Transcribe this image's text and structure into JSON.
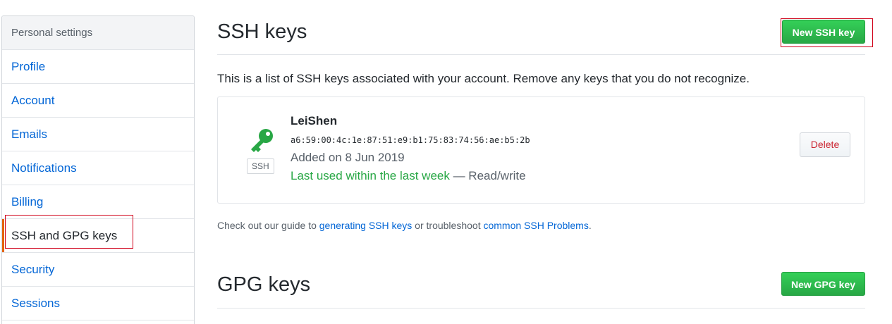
{
  "sidebar": {
    "header": "Personal settings",
    "items": [
      {
        "label": "Profile"
      },
      {
        "label": "Account"
      },
      {
        "label": "Emails"
      },
      {
        "label": "Notifications"
      },
      {
        "label": "Billing"
      },
      {
        "label": "SSH and GPG keys",
        "selected": true
      },
      {
        "label": "Security"
      },
      {
        "label": "Sessions"
      }
    ]
  },
  "ssh": {
    "title": "SSH keys",
    "new_button": "New SSH key",
    "intro": "This is a list of SSH keys associated with your account. Remove any keys that you do not recognize.",
    "key": {
      "badge": "SSH",
      "name": "LeiShen",
      "fingerprint": "a6:59:00:4c:1e:87:51:e9:b1:75:83:74:56:ae:b5:2b",
      "added": "Added on 8 Jun 2019",
      "last_used": "Last used within the last week",
      "access": " — Read/write",
      "delete_label": "Delete",
      "icon": "key-icon",
      "icon_color": "#28a745"
    },
    "guide": {
      "prefix": "Check out our guide to ",
      "link1": "generating SSH keys",
      "middle": " or troubleshoot ",
      "link2": "common SSH Problems",
      "suffix": "."
    }
  },
  "gpg": {
    "title": "GPG keys",
    "new_button": "New GPG key"
  },
  "colors": {
    "accent_green": "#28a745",
    "link_blue": "#0366d6",
    "selected_bar": "#e36209",
    "danger": "#cb2431"
  }
}
